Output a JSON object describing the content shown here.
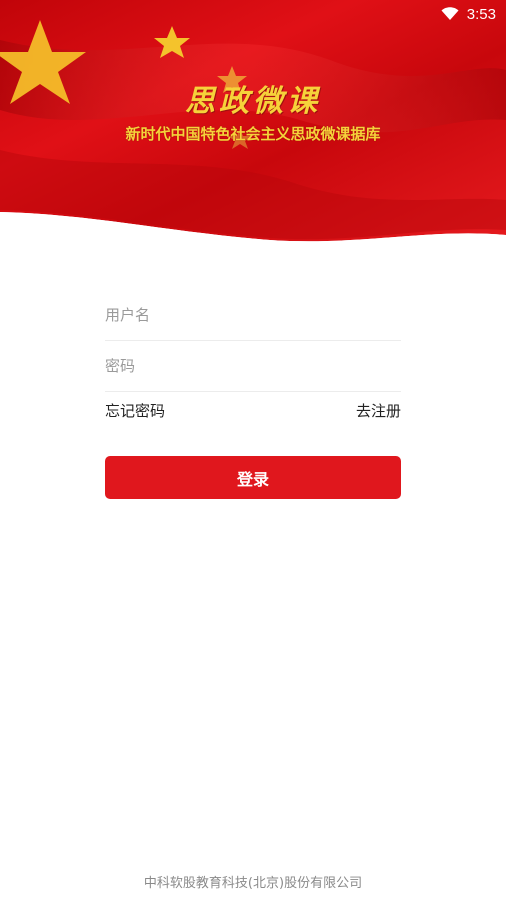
{
  "status_bar": {
    "time": "3:53",
    "wifi_icon": "wifi-icon"
  },
  "banner": {
    "title": "思政微课",
    "subtitle": "新时代中国特色社会主义思政微课据库",
    "flag_color": "#d8080e",
    "text_color": "#f6d23a"
  },
  "form": {
    "username_placeholder": "用户名",
    "password_placeholder": "密码",
    "forgot_password": "忘记密码",
    "register": "去注册",
    "login_label": "登录",
    "accent": "#e0171d"
  },
  "footer": {
    "company": "中科软股教育科技(北京)股份有限公司"
  }
}
